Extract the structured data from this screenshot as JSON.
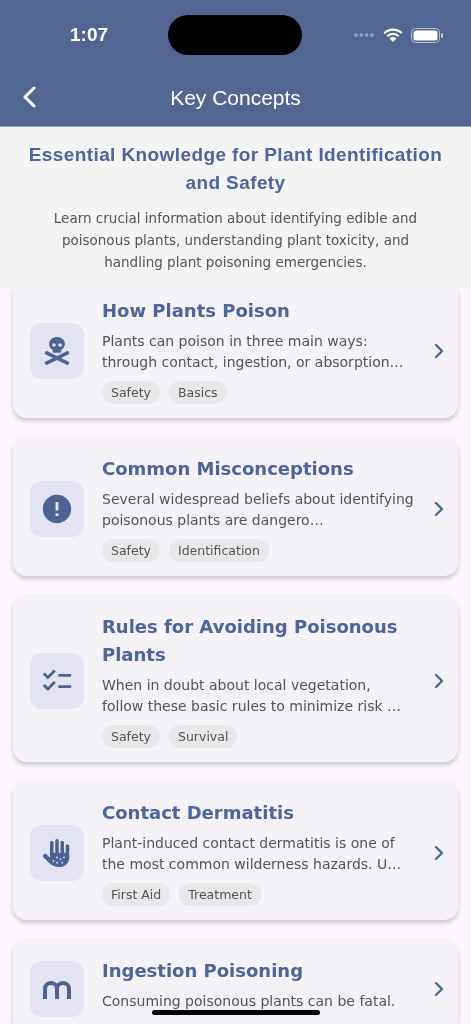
{
  "status_bar": {
    "time": "1:07"
  },
  "nav": {
    "title": "Key Concepts"
  },
  "header": {
    "title": "Essential Knowledge for Plant Identification and Safety",
    "description": "Learn crucial information about identifying edible and poisonous plants, understanding plant toxicity, and handling plant poisoning emergencies."
  },
  "cards": [
    {
      "title": "How Plants Poison",
      "description": "Plants can poison in three main ways: through contact, ingestion, or absorption…",
      "tags": [
        "Safety",
        "Basics"
      ]
    },
    {
      "title": "Common Misconceptions",
      "description": "Several widespread beliefs about identifying poisonous plants are dangero…",
      "tags": [
        "Safety",
        "Identification"
      ]
    },
    {
      "title": "Rules for Avoiding Poisonous Plants",
      "description": "When in doubt about local vegetation, follow these basic rules to minimize risk …",
      "tags": [
        "Safety",
        "Survival"
      ]
    },
    {
      "title": "Contact Dermatitis",
      "description": "Plant-induced contact dermatitis is one of the most common wilderness hazards. U…",
      "tags": [
        "First Aid",
        "Treatment"
      ]
    },
    {
      "title": "Ingestion Poisoning",
      "description": "Consuming poisonous plants can be fatal."
    }
  ]
}
